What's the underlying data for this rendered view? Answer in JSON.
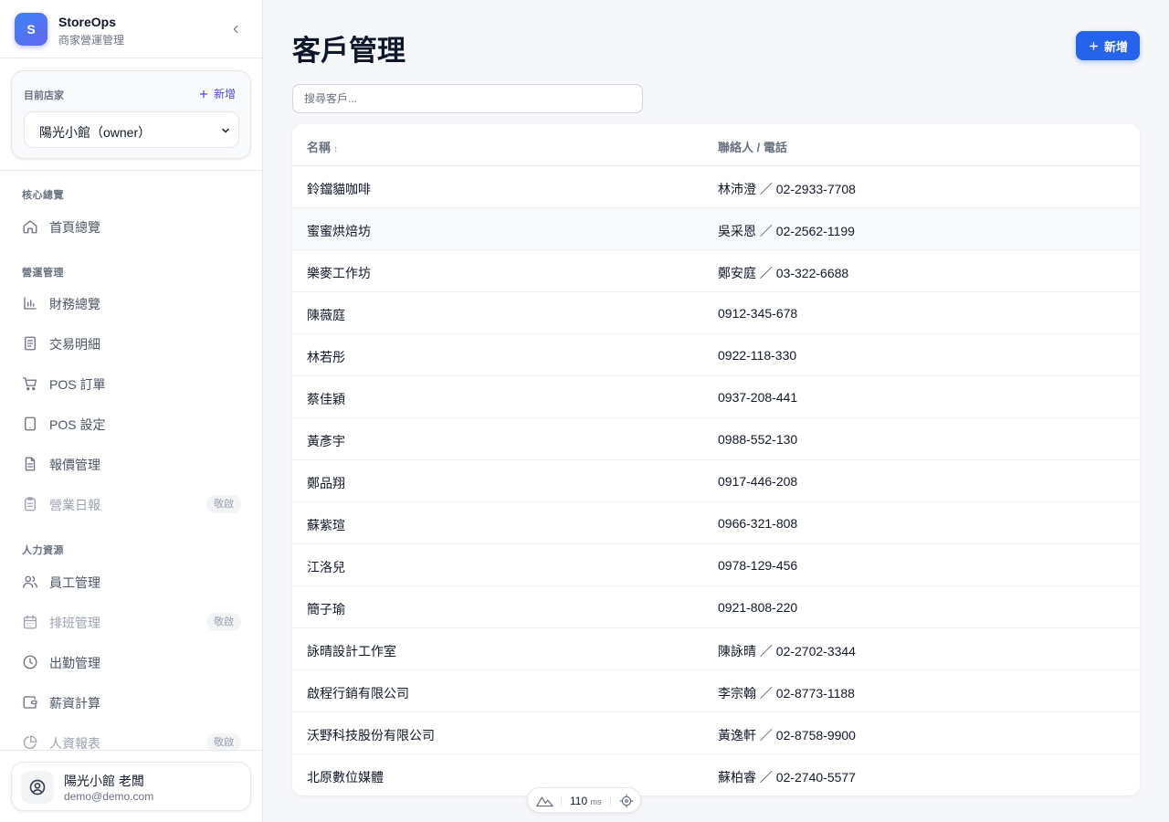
{
  "brand": {
    "logo_letter": "S",
    "title": "StoreOps",
    "subtitle": "商家營運管理"
  },
  "store": {
    "label": "目前店家",
    "add_label": "新增",
    "selected": "陽光小館（owner）"
  },
  "nav": {
    "sections": [
      {
        "title": "核心總覽",
        "items": [
          {
            "label": "首頁總覽",
            "icon": "home-icon"
          }
        ]
      },
      {
        "title": "營運管理",
        "items": [
          {
            "label": "財務總覽",
            "icon": "bar-chart-icon"
          },
          {
            "label": "交易明細",
            "icon": "receipt-icon"
          },
          {
            "label": "POS 訂單",
            "icon": "cart-icon"
          },
          {
            "label": "POS 設定",
            "icon": "tablet-icon"
          },
          {
            "label": "報價管理",
            "icon": "document-icon"
          },
          {
            "label": "營業日報",
            "icon": "clipboard-icon",
            "badge": "敬啟"
          }
        ]
      },
      {
        "title": "人力資源",
        "items": [
          {
            "label": "員工管理",
            "icon": "users-icon"
          },
          {
            "label": "排班管理",
            "icon": "calendar-icon",
            "badge": "敬啟"
          },
          {
            "label": "出勤管理",
            "icon": "clock-icon"
          },
          {
            "label": "薪資計算",
            "icon": "wallet-icon"
          },
          {
            "label": "人資報表",
            "icon": "pie-chart-icon",
            "badge": "敬啟"
          }
        ]
      }
    ]
  },
  "user": {
    "name": "陽光小館 老闆",
    "email": "demo@demo.com"
  },
  "page": {
    "title": "客戶管理",
    "add_label": "新增",
    "search_placeholder": "搜尋客戶..."
  },
  "table": {
    "columns": [
      {
        "label": "名稱",
        "sort": "↕"
      },
      {
        "label": "聯絡人 / 電話"
      }
    ],
    "rows": [
      {
        "name": "鈴鐺貓咖啡",
        "contact": "林沛澄 ／ 02-2933-7708"
      },
      {
        "name": "蜜蜜烘焙坊",
        "contact": "吳采恩 ／ 02-2562-1199"
      },
      {
        "name": "樂麥工作坊",
        "contact": "鄭安庭 ／ 03-322-6688"
      },
      {
        "name": "陳薇庭",
        "contact": "0912-345-678"
      },
      {
        "name": "林若彤",
        "contact": "0922-118-330"
      },
      {
        "name": "蔡佳穎",
        "contact": "0937-208-441"
      },
      {
        "name": "黃彥宇",
        "contact": "0988-552-130"
      },
      {
        "name": "鄭品翔",
        "contact": "0917-446-208"
      },
      {
        "name": "蘇紫瑄",
        "contact": "0966-321-808"
      },
      {
        "name": "江洛兒",
        "contact": "0978-129-456"
      },
      {
        "name": "簡子瑜",
        "contact": "0921-808-220"
      },
      {
        "name": "詠晴設計工作室",
        "contact": "陳詠晴 ／ 02-2702-3344"
      },
      {
        "name": "啟程行銷有限公司",
        "contact": "李宗翰 ／ 02-8773-1188"
      },
      {
        "name": "沃野科技股份有限公司",
        "contact": "黃逸軒 ／ 02-8758-9900"
      },
      {
        "name": "北原數位媒體",
        "contact": "蘇柏睿 ／ 02-2740-5577"
      }
    ]
  },
  "status": {
    "value": "110",
    "unit": "ms"
  },
  "colors": {
    "accent": "#2563eb",
    "brand_gradient_start": "#3b82f6",
    "brand_gradient_end": "#6366f1",
    "link": "#4f46e5"
  }
}
